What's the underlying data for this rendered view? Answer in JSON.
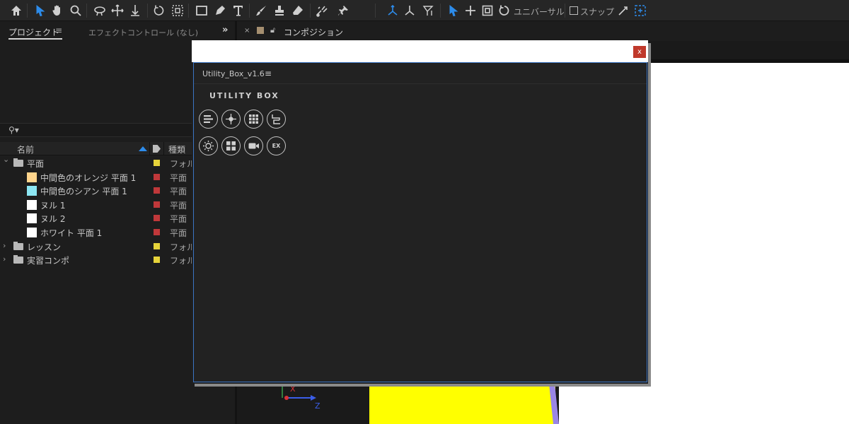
{
  "toolbar": {
    "tools": [
      "home-icon",
      "selection-icon",
      "hand-icon",
      "zoom-icon",
      "orbit-icon",
      "pan-under-icon",
      "dolly-icon",
      "rotate-icon",
      "camera-track-icon",
      "rectangle-icon",
      "pen-icon",
      "type-icon",
      "brush-icon",
      "clone-stamp-icon",
      "eraser-icon",
      "roto-brush-icon",
      "puppet-pin-icon"
    ],
    "axis_tools": [
      "local-axis-icon",
      "world-axis-icon",
      "view-axis-icon"
    ],
    "universal_label": "ユニバーサル",
    "snap_label": "スナップ",
    "accent": "#2d8ceb"
  },
  "project_panel": {
    "tab_label": "プロジェクト",
    "effects_tab_label": "エフェクトコントロール (なし)",
    "more_label": "»",
    "search_placeholder": "",
    "columns": {
      "name": "名前",
      "type": "種類"
    },
    "items": [
      {
        "name": "平面",
        "type": "フォル",
        "kind": "folder",
        "expanded": true,
        "indent": 0,
        "label_color": "#e6d33a"
      },
      {
        "name": "中間色のオレンジ 平面 1",
        "type": "平面",
        "kind": "solid",
        "indent": 1,
        "swatch": "#ffd58c",
        "label_color": "#c0383a"
      },
      {
        "name": "中間色のシアン 平面 1",
        "type": "平面",
        "kind": "solid",
        "indent": 1,
        "swatch": "#8ce6f2",
        "label_color": "#c0383a"
      },
      {
        "name": "ヌル 1",
        "type": "平面",
        "kind": "solid",
        "indent": 1,
        "swatch": "#ffffff",
        "label_color": "#c0383a"
      },
      {
        "name": "ヌル 2",
        "type": "平面",
        "kind": "solid",
        "indent": 1,
        "swatch": "#ffffff",
        "label_color": "#c0383a"
      },
      {
        "name": "ホワイト 平面 1",
        "type": "平面",
        "kind": "solid",
        "indent": 1,
        "swatch": "#ffffff",
        "label_color": "#c0383a"
      },
      {
        "name": "レッスン",
        "type": "フォル",
        "kind": "folder",
        "expanded": false,
        "indent": 0,
        "label_color": "#e6d33a"
      },
      {
        "name": "実習コンポ",
        "type": "フォル",
        "kind": "folder",
        "expanded": false,
        "indent": 0,
        "label_color": "#e6d33a"
      }
    ]
  },
  "composition": {
    "close_label": "×",
    "tab_label": "コンポジション",
    "swatch": "#a58f70",
    "axis_x": "X",
    "axis_z": "Z"
  },
  "utility_box": {
    "close_label": "x",
    "tab_label": "Utility_Box_v1.6",
    "menu_label": "≡",
    "brand": "UTILITY BOX",
    "buttons_row1": [
      "align-icon",
      "anchor-point-icon",
      "grid-icon",
      "parent-icon"
    ],
    "buttons_row2": [
      "settings-icon",
      "distribute-icon",
      "camera-icon",
      "ex"
    ],
    "ex_label": "EX"
  }
}
